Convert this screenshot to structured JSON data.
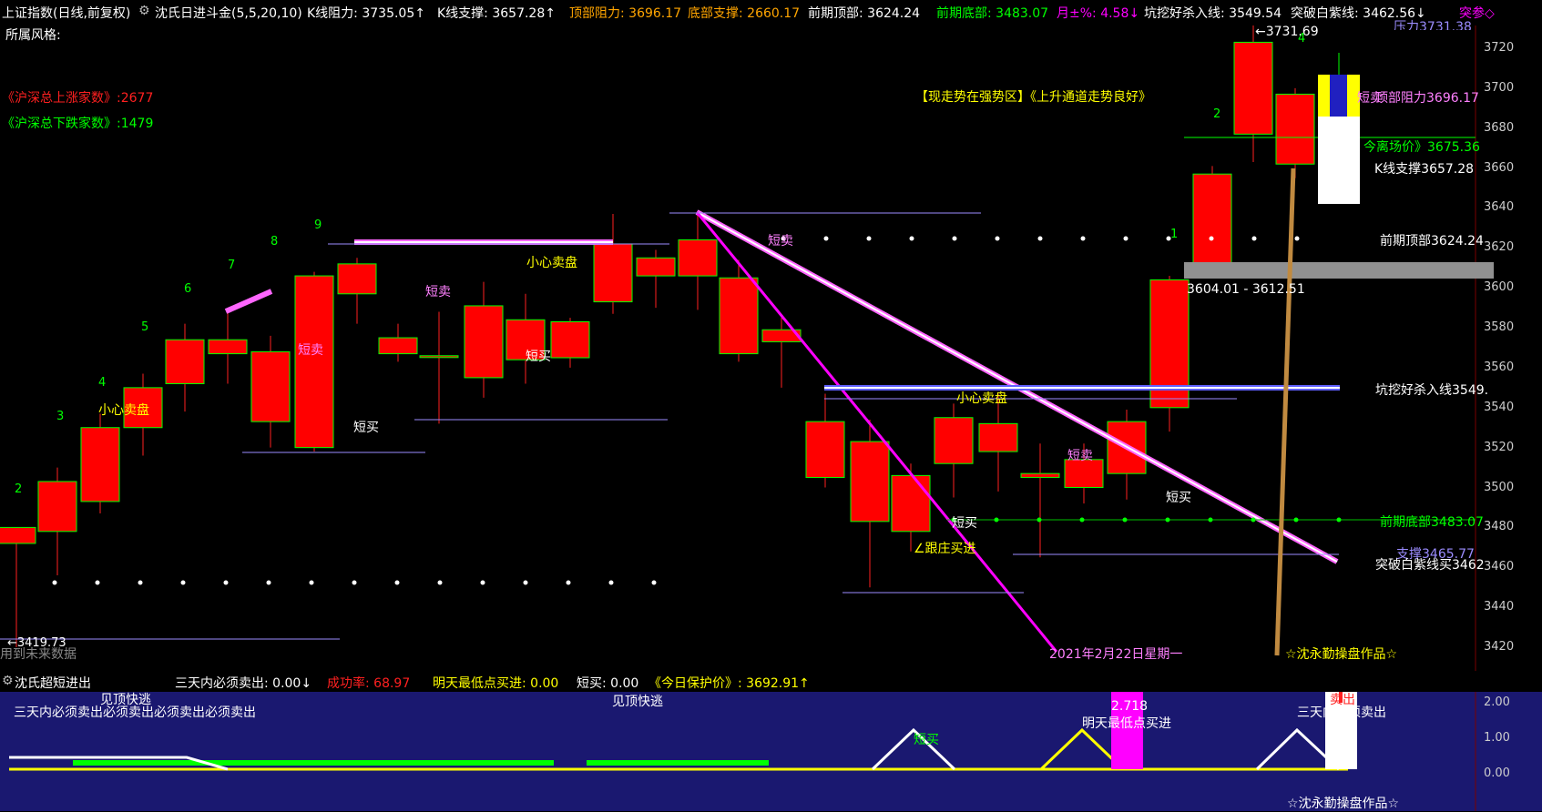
{
  "header": {
    "index_name": "上证指数(日线,前复权)",
    "indicator": "沈氏日进斗金(5,5,20,10)",
    "k_resist": "K线阻力: 3735.05↑",
    "k_support": "K线支撑: 3657.28↑",
    "top_resist": "顶部阻力: 3696.17",
    "bottom_support": "底部支撑: 2660.17",
    "prev_top": "前期顶部: 3624.24",
    "prev_bottom": "前期底部: 3483.07",
    "month_pct": "月±%: 4.58↓",
    "pit_line": "坑挖好杀入线: 3549.54",
    "breakout_line": "突破白紫线: 3462.56↓",
    "tail": "突参◇"
  },
  "style_label": "所属风格:",
  "left_stats": {
    "up_count": "《沪深总上涨家数》:2677",
    "down_count": "《沪深总下跌家数》:1479"
  },
  "status_text": "【现走势在强势区】《上升通道走势良好》",
  "annotations": {
    "careful_sell_1": "小心卖盘",
    "careful_sell_2": "小心卖盘",
    "careful_sell_3": "小心卖盘",
    "short_sell": "短卖",
    "short_buy": "短买",
    "follow_buy": "∠跟庄买进",
    "top_resist": "顶部阻力3696.17",
    "today_price": "今离场价》3675.36",
    "k_support": "K线支撑3657.28",
    "prev_top": "前期顶部3624.24",
    "range": "3604.01 - 3612.51",
    "pit_line": "坑挖好杀入线3549.",
    "prev_bottom": "前期底部3483.07",
    "support": "支撑3465.77",
    "breakout": "突破白紫线买3462",
    "high_label": "←3731.69",
    "low_label": "←3419.73",
    "no_data": "用到未来数据",
    "date": "2021年2月22日星期一",
    "author": "☆沈永勤操盘作品☆",
    "resist_cut": "压力3731.38"
  },
  "wave_numbers": [
    "2",
    "3",
    "4",
    "5",
    "6",
    "7",
    "8",
    "9",
    "1",
    "2",
    "4"
  ],
  "price_axis": [
    "3720",
    "3700",
    "3680",
    "3660",
    "3640",
    "3620",
    "3600",
    "3580",
    "3560",
    "3540",
    "3520",
    "3500",
    "3480",
    "3460",
    "3440",
    "3420"
  ],
  "lower_panel": {
    "title": "沈氏超短进出",
    "must_sell": "三天内必须卖出: 0.00↓",
    "success_rate": "成功率: 68.97",
    "tomorrow_low": "明天最低点买进: 0.00",
    "short_buy": "短买: 0.00",
    "protect_price": "《今日保护价》: 3692.91↑",
    "axis": [
      "2.00",
      "1.00",
      "0.00"
    ],
    "text_must_sell_overlap": "三天内必须卖出必须卖出必须卖出必须卖出",
    "text_peak_escape_1": "见顶快逃",
    "text_peak_escape_2": "见顶快逃",
    "text_short_buy": "短买",
    "text_value": "2.718",
    "text_tomorrow": "明天最低点买进",
    "text_must_sell_right": "三天内必须卖出",
    "text_sell": "卖出",
    "author": "☆沈永勤操盘作品☆"
  },
  "colors": {
    "up": "#ff0000",
    "down": "#ff0000",
    "green": "#00ff00",
    "yellow": "#ffff00",
    "magenta": "#ff00ff",
    "panel": "#1a1870"
  },
  "chart_data": {
    "type": "candlestick",
    "ylim": [
      3410,
      3730
    ],
    "candles": [
      {
        "open": 3480,
        "close": 3472,
        "high": 3476,
        "low": 3420
      },
      {
        "open": 3478,
        "close": 3503,
        "high": 3510,
        "low": 3456
      },
      {
        "open": 3493,
        "close": 3530,
        "high": 3537,
        "low": 3487
      },
      {
        "open": 3530,
        "close": 3550,
        "high": 3557,
        "low": 3516
      },
      {
        "open": 3552,
        "close": 3574,
        "high": 3582,
        "low": 3538
      },
      {
        "open": 3567,
        "close": 3574,
        "high": 3590,
        "low": 3552
      },
      {
        "open": 3568,
        "close": 3533,
        "high": 3576,
        "low": 3520
      },
      {
        "open": 3606,
        "close": 3520,
        "high": 3608,
        "low": 3518
      },
      {
        "open": 3597,
        "close": 3612,
        "high": 3615,
        "low": 3582
      },
      {
        "open": 3575,
        "close": 3567,
        "high": 3582,
        "low": 3563
      },
      {
        "open": 3566,
        "close": 3566,
        "high": 3588,
        "low": 3532
      },
      {
        "open": 3591,
        "close": 3555,
        "high": 3603,
        "low": 3545
      },
      {
        "open": 3584,
        "close": 3564,
        "high": 3597,
        "low": 3552
      },
      {
        "open": 3583,
        "close": 3565,
        "high": 3585,
        "low": 3560
      },
      {
        "open": 3622,
        "close": 3593,
        "high": 3637,
        "low": 3587
      },
      {
        "open": 3615,
        "close": 3606,
        "high": 3619,
        "low": 3590
      },
      {
        "open": 3624,
        "close": 3606,
        "high": 3638,
        "low": 3589
      },
      {
        "open": 3605,
        "close": 3567,
        "high": 3614,
        "low": 3563
      },
      {
        "open": 3579,
        "close": 3573,
        "high": 3585,
        "low": 3550
      },
      {
        "open": 3533,
        "close": 3505,
        "high": 3547,
        "low": 3500
      },
      {
        "open": 3523,
        "close": 3483,
        "high": 3534,
        "low": 3450
      },
      {
        "open": 3506,
        "close": 3478,
        "high": 3512,
        "low": 3468
      },
      {
        "open": 3535,
        "close": 3512,
        "high": 3542,
        "low": 3495
      },
      {
        "open": 3532,
        "close": 3518,
        "high": 3547,
        "low": 3498
      },
      {
        "open": 3507,
        "close": 3505,
        "high": 3522,
        "low": 3465
      },
      {
        "open": 3514,
        "close": 3500,
        "high": 3522,
        "low": 3492
      },
      {
        "open": 3533,
        "close": 3507,
        "high": 3539,
        "low": 3494
      },
      {
        "open": 3604,
        "close": 3540,
        "high": 3606,
        "low": 3528
      },
      {
        "open": 3657,
        "close": 3611,
        "high": 3661,
        "low": 3607
      },
      {
        "open": 3723,
        "close": 3677,
        "high": 3732,
        "low": 3663
      },
      {
        "open": 3697,
        "close": 3662,
        "high": 3700,
        "low": 3655
      }
    ]
  }
}
